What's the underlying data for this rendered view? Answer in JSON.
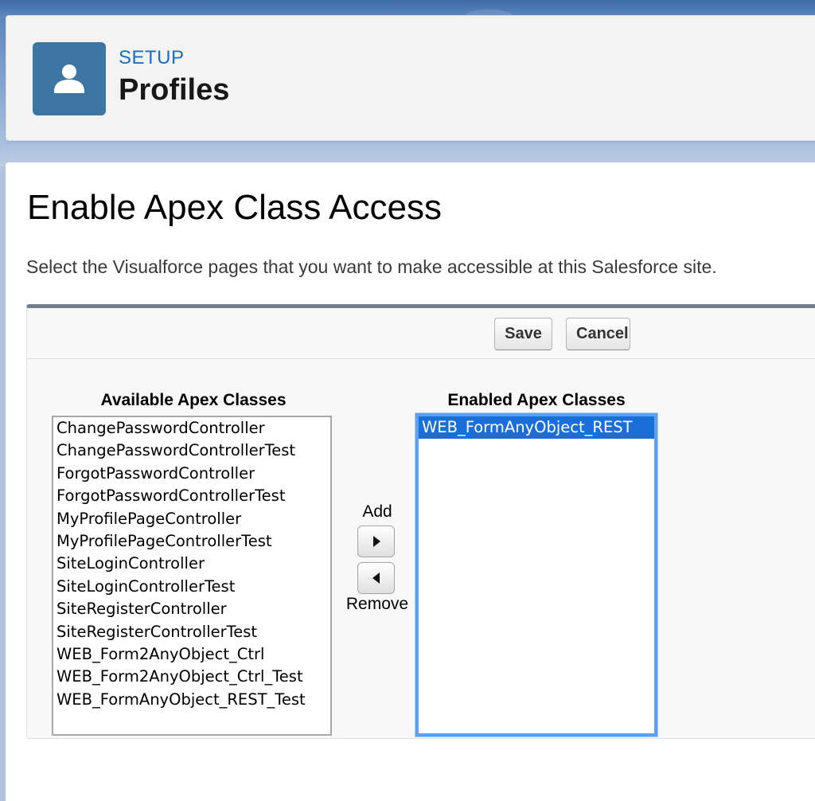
{
  "header": {
    "section": "SETUP",
    "title": "Profiles",
    "icon": "user-icon"
  },
  "page": {
    "heading": "Enable Apex Class Access",
    "description": "Select the Visualforce pages that you want to make accessible at this Salesforce site."
  },
  "toolbar": {
    "save_label": "Save",
    "cancel_label": "Cancel"
  },
  "available": {
    "title": "Available Apex Classes",
    "items": [
      "ChangePasswordController",
      "ChangePasswordControllerTest",
      "ForgotPasswordController",
      "ForgotPasswordControllerTest",
      "MyProfilePageController",
      "MyProfilePageControllerTest",
      "SiteLoginController",
      "SiteLoginControllerTest",
      "SiteRegisterController",
      "SiteRegisterControllerTest",
      "WEB_Form2AnyObject_Ctrl",
      "WEB_Form2AnyObject_Ctrl_Test",
      "WEB_FormAnyObject_REST_Test"
    ]
  },
  "enabled": {
    "title": "Enabled Apex Classes",
    "items": [
      "WEB_FormAnyObject_REST"
    ],
    "selected": "WEB_FormAnyObject_REST"
  },
  "mover": {
    "add_label": "Add",
    "remove_label": "Remove"
  },
  "colors": {
    "accent": "#1a6ec6",
    "icon_bg": "#3d76a3",
    "selection": "#1a6ed8"
  }
}
